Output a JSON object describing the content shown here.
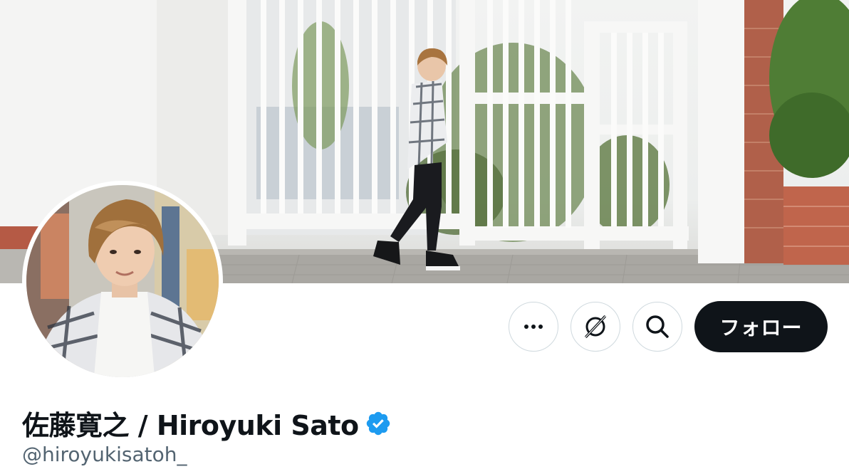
{
  "profile": {
    "display_name": "佐藤寛之 / Hiroyuki Sato",
    "handle": "@hiroyukisatoh_",
    "verified": true,
    "verified_badge_color": "#1d9bf0"
  },
  "actions": {
    "more_icon": "more-dots-icon",
    "grok_icon": "grok-icon",
    "search_icon": "search-icon",
    "follow_label": "フォロー"
  },
  "colors": {
    "follow_button_bg": "#0f1419",
    "follow_button_text": "#ffffff",
    "handle_text": "#536471",
    "button_border": "#cfd9de"
  }
}
